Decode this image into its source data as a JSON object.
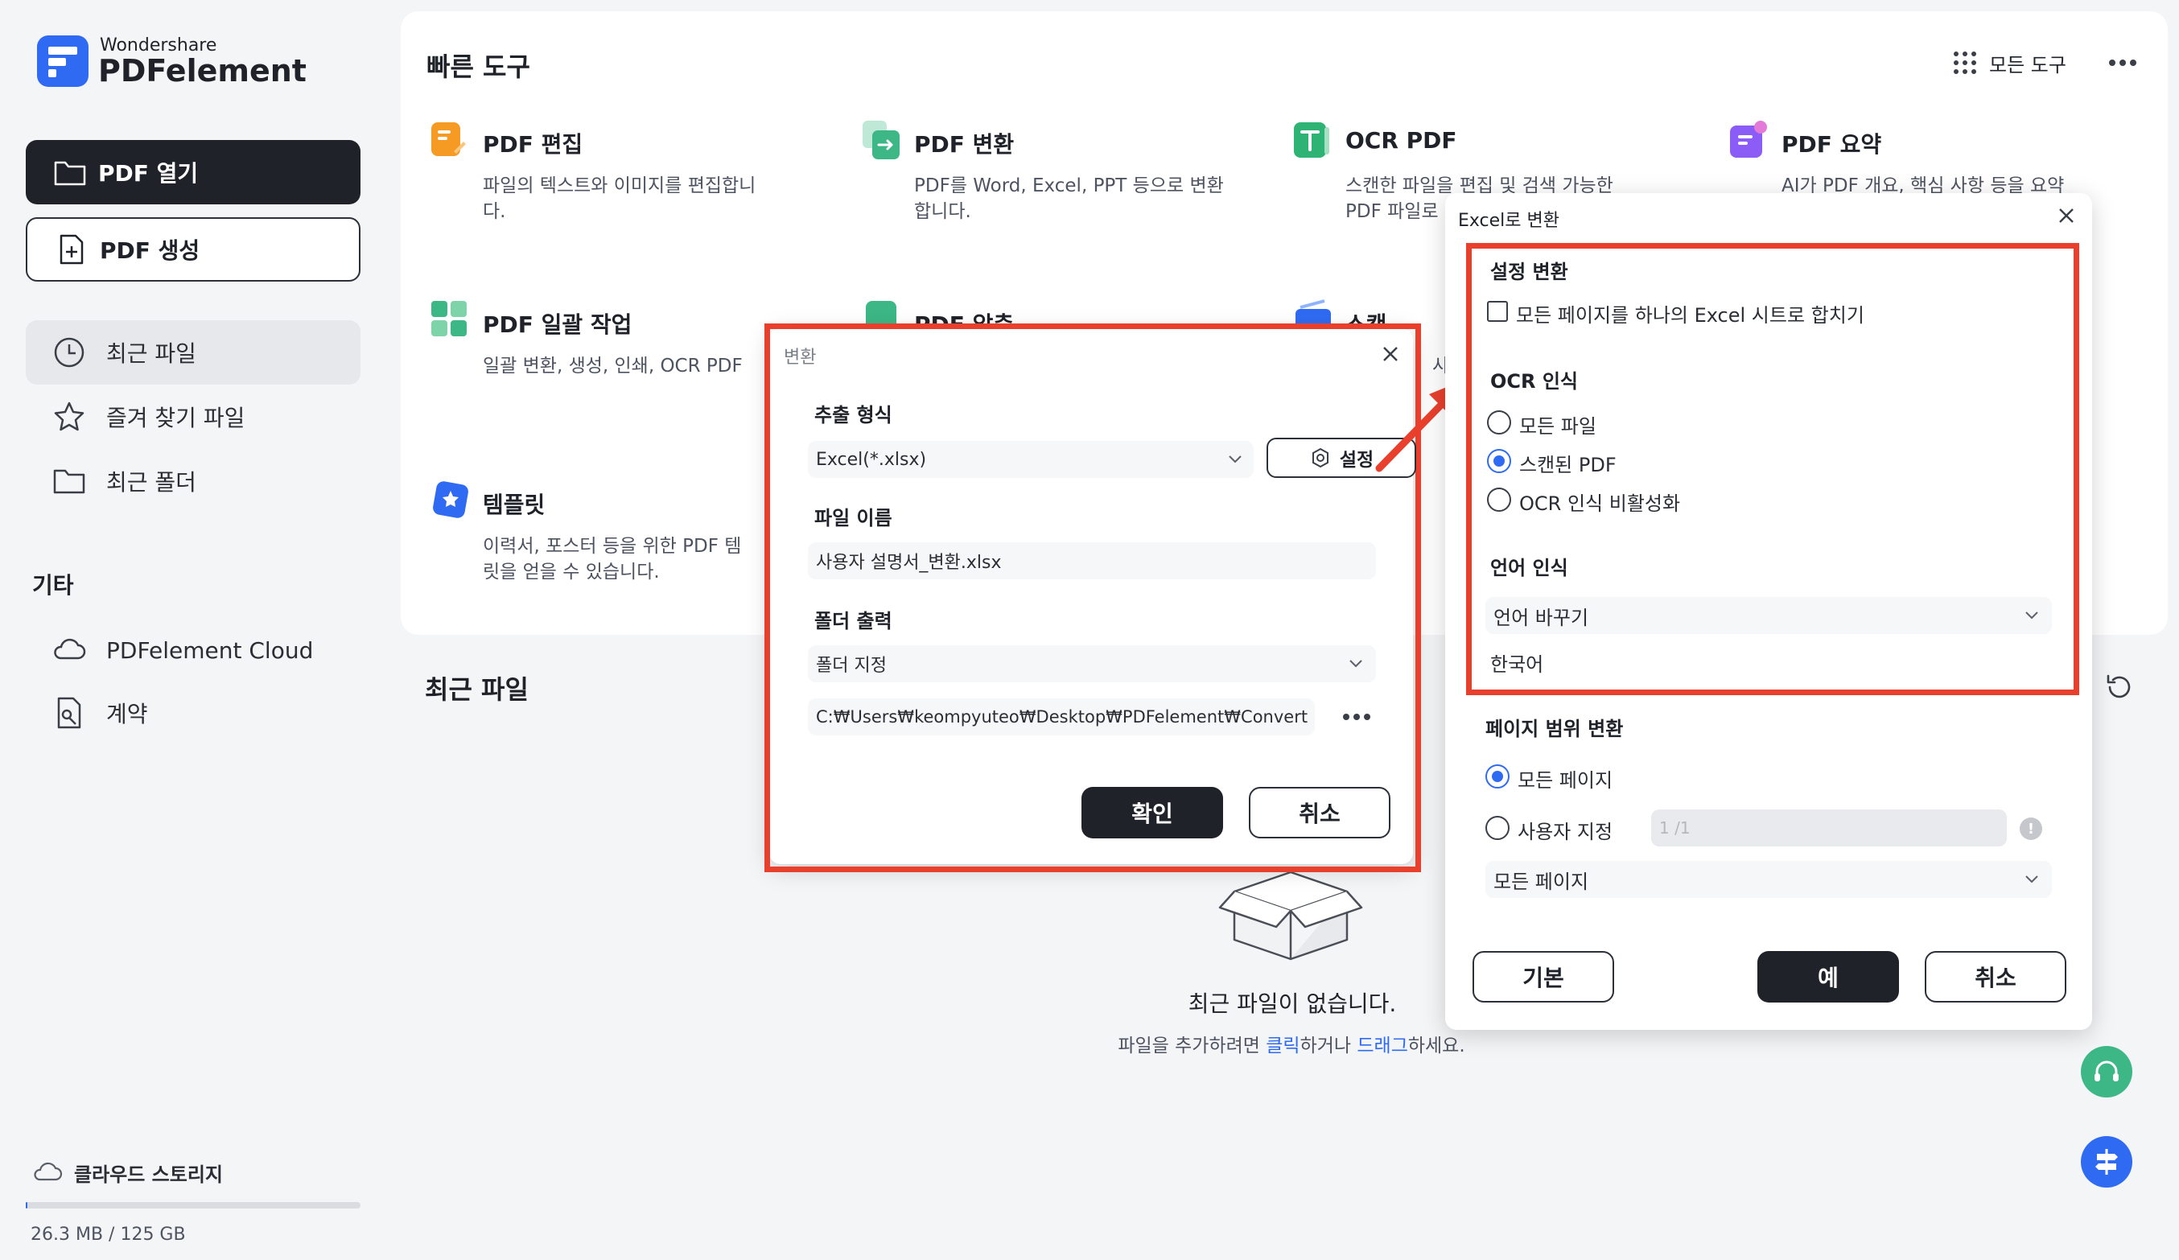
{
  "app": {
    "brand_top": "Wondershare",
    "brand_name": "PDFelement",
    "accent_color": "#2f6bf2",
    "highlight_color": "#e8402d"
  },
  "sidebar": {
    "open_pdf": "PDF 열기",
    "create_pdf": "PDF 생성",
    "nav": [
      {
        "label": "최근 파일",
        "icon": "clock-icon"
      },
      {
        "label": "즐겨 찾기 파일",
        "icon": "star-icon"
      },
      {
        "label": "최근 폴더",
        "icon": "folder-icon"
      }
    ],
    "other_heading": "기타",
    "other": [
      {
        "label": "PDFelement Cloud",
        "icon": "cloud-icon"
      },
      {
        "label": "계약",
        "icon": "contract-icon"
      }
    ],
    "storage_label": "클라우드 스토리지",
    "storage_usage": "26.3 MB / 125 GB",
    "storage_fraction": 0.0002
  },
  "quick_tools": {
    "heading": "빠른 도구",
    "all_tools": "모든 도구",
    "tools": [
      {
        "title": "PDF 편집",
        "desc": [
          "파일의 텍스트와 이미지를 편집합니",
          "다."
        ],
        "icon": "edit-icon"
      },
      {
        "title": "PDF 변환",
        "desc": [
          "PDF를 Word, Excel, PPT 등으로 변환",
          "합니다."
        ],
        "icon": "convert-icon"
      },
      {
        "title": "OCR PDF",
        "desc": [
          "스캔한 파일을 편집 및 검색 가능한",
          "PDF 파일로"
        ],
        "icon": "ocr-icon"
      },
      {
        "title": "PDF 요약",
        "desc": [
          "AI가 PDF 개요, 핵심 사항 등을 요약",
          ""
        ],
        "icon": "summary-icon"
      },
      {
        "title": "PDF 일괄 작업",
        "desc": [
          "일괄 변환, 생성, 인쇄, OCR PDF",
          ""
        ],
        "icon": "batch-icon"
      },
      {
        "title": "PDF 압축",
        "desc": [
          "",
          ""
        ],
        "icon": "compress-icon"
      },
      {
        "title": "스캔",
        "desc": [
          "사",
          ""
        ],
        "icon": "scan-icon"
      },
      {
        "title": "템플릿",
        "desc": [
          "이력서, 포스터 등을 위한 PDF 템",
          "릿을 얻을 수 있습니다."
        ],
        "icon": "template-icon"
      }
    ]
  },
  "recent": {
    "heading": "최근 파일",
    "empty_title": "최근 파일이 없습니다.",
    "hint_pre": "파일을 추가하려면 ",
    "hint_click": "클릭",
    "hint_mid": "하거나 ",
    "hint_drag": "드래그",
    "hint_post": "하세요."
  },
  "convert_dialog": {
    "title": "변환",
    "format_label": "추출 형식",
    "format_value": "Excel(*.xlsx)",
    "settings_button": "설정",
    "filename_label": "파일 이름",
    "filename_value": "사용자 설명서_변환.xlsx",
    "folder_label": "폴더 출력",
    "folder_value": "폴더 지정",
    "path_value": "C:₩Users₩keompyuteo₩Desktop₩PDFelement₩Convert",
    "ok": "확인",
    "cancel": "취소"
  },
  "excel_dialog": {
    "title": "Excel로 변환",
    "settings_heading": "설정 변환",
    "merge_label": "모든 페이지를 하나의 Excel 시트로 합치기",
    "merge_checked": false,
    "ocr_heading": "OCR 인식",
    "ocr_options": [
      "모든 파일",
      "스캔된 PDF",
      "OCR 인식 비활성화"
    ],
    "ocr_selected": 1,
    "lang_heading": "언어 인식",
    "lang_select": "언어 바꾸기",
    "lang_value": "한국어",
    "range_heading": "페이지 범위 변환",
    "range_options": [
      "모든 페이지",
      "사용자 지정"
    ],
    "range_selected": 0,
    "range_input_placeholder": "1 /1",
    "range_select": "모든 페이지",
    "default_button": "기본",
    "yes_button": "예",
    "cancel_button": "취소"
  }
}
